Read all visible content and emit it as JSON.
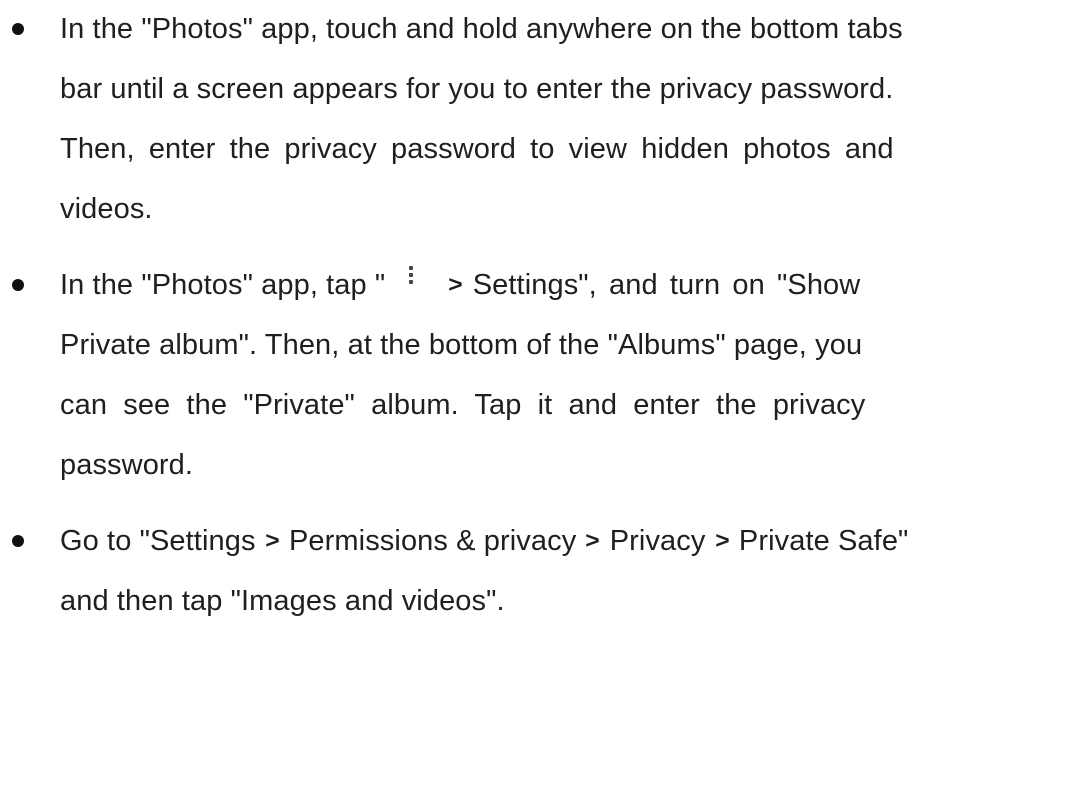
{
  "bullets": [
    {
      "lines": [
        "In the \"Photos\" app, touch and hold anywhere on the bottom tabs",
        "bar until a screen appears for you to enter the privacy password.",
        "Then, enter the privacy password to view hidden photos and",
        "videos."
      ]
    },
    {
      "line1_prefix": "In the \"Photos\" app, tap \"",
      "icon": "more-vertical-icon",
      "gt": ">",
      "line1_suffix": "Settings\", and turn on \"Show",
      "lines_rest": [
        "Private album\". Then, at the bottom of the \"Albums\" page, you",
        "can see the \"Private\" album. Tap it and enter the privacy",
        "password."
      ]
    },
    {
      "line1_parts": [
        "Go to \"Settings",
        ">",
        "Permissions & privacy",
        ">",
        "Privacy",
        ">",
        "Private Safe\""
      ],
      "line2": "and then tap \"Images and videos\"."
    }
  ]
}
